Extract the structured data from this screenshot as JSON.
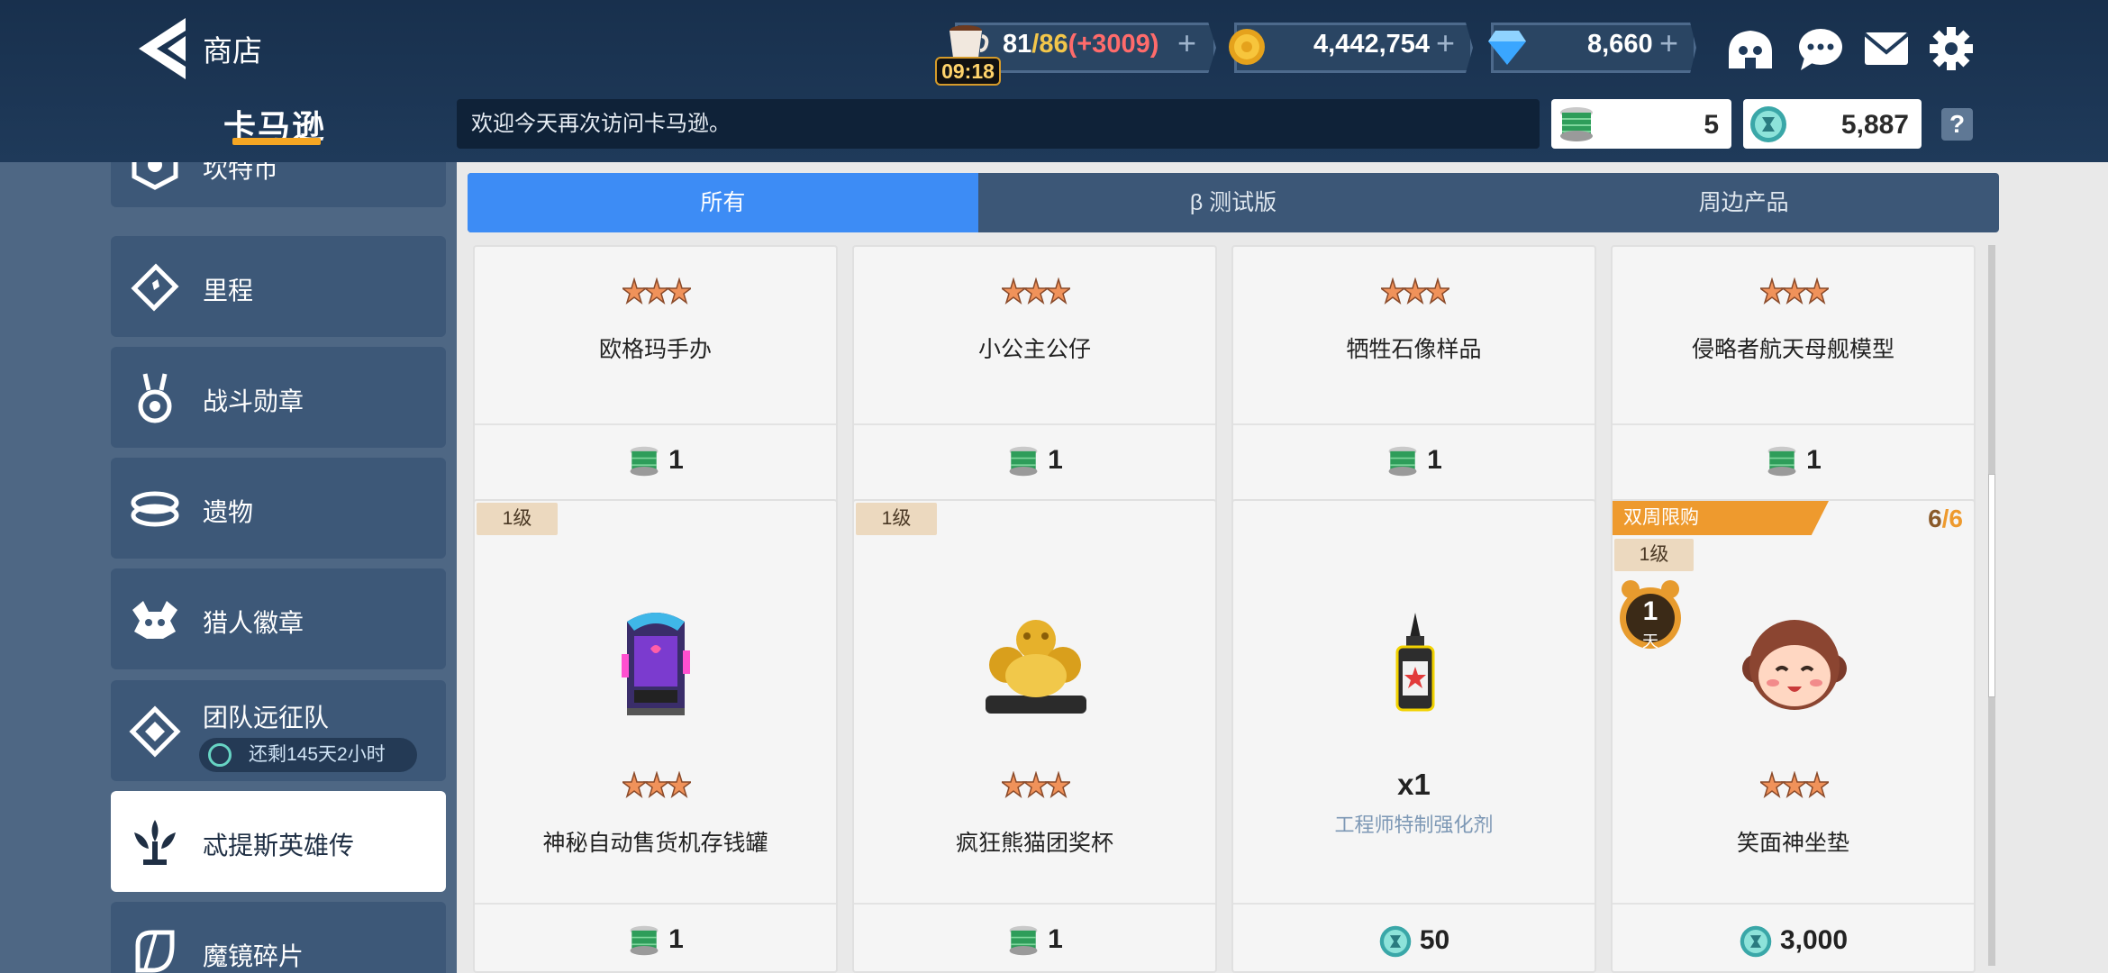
{
  "header": {
    "title": "商店",
    "subtitle": "卡马逊",
    "stamina": {
      "current": "81",
      "max": "/86",
      "bonus": "(+3009)",
      "timer": "09:18"
    },
    "coins": "4,442,754",
    "gems": "8,660",
    "plus": "+"
  },
  "notice": "欢迎今天再次访问卡马逊。",
  "currencies": {
    "thread": "5",
    "shard": "5,887"
  },
  "help": "?",
  "sidebar": {
    "items": [
      {
        "label": "坎特币",
        "icon": "kant-coin-icon"
      },
      {
        "label": "里程",
        "icon": "ticket-icon"
      },
      {
        "label": "战斗勋章",
        "icon": "medal-icon"
      },
      {
        "label": "遗物",
        "icon": "relic-icon"
      },
      {
        "label": "猎人徽章",
        "icon": "hunter-badge-icon"
      },
      {
        "label": "团队远征队",
        "icon": "expedition-icon",
        "time": "还剩145天2小时"
      },
      {
        "label": "忒提斯英雄传",
        "icon": "hero-legend-icon"
      },
      {
        "label": "魔镜碎片",
        "icon": "mirror-shard-icon"
      }
    ]
  },
  "tabs": [
    "所有",
    "β 测试版",
    "周边产品"
  ],
  "products_top": [
    {
      "name": "欧格玛手办",
      "price": "1"
    },
    {
      "name": "小公主公仔",
      "price": "1"
    },
    {
      "name": "牺牲石像样品",
      "price": "1"
    },
    {
      "name": "侵略者航天母舰模型",
      "price": "1"
    }
  ],
  "products_bottom": [
    {
      "name": "神秘自动售货机存钱罐",
      "level": "1级",
      "price": "1",
      "currency": "thread",
      "icon": "vending-machine-icon"
    },
    {
      "name": "疯狂熊猫团奖杯",
      "level": "1级",
      "price": "1",
      "currency": "thread",
      "icon": "gold-trophy-icon"
    },
    {
      "name": "工程师特制强化剂",
      "qty": "x1",
      "price": "50",
      "currency": "shard",
      "icon": "booster-bottle-icon"
    },
    {
      "name": "笑面神坐垫",
      "level": "1级",
      "price": "3,000",
      "currency": "shard",
      "ribbon": "双周限购",
      "limit_used": "6",
      "limit_sep": "/",
      "limit_total": "6",
      "timer_num": "1",
      "timer_unit": "天",
      "icon": "smiling-cushion-icon"
    }
  ],
  "colors": {
    "accent": "#3d8cf5",
    "ribbon": "#ee9a2e",
    "star": "#f0925a"
  }
}
